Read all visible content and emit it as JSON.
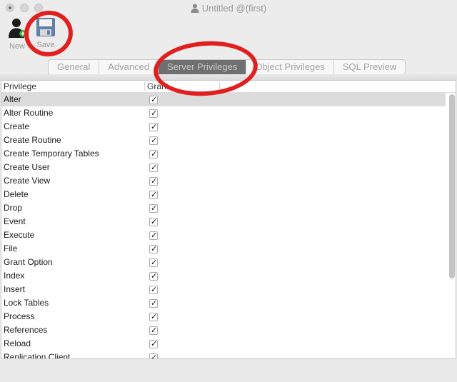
{
  "window": {
    "title": "Untitled @(first)"
  },
  "toolbar": {
    "new_label": "New",
    "save_label": "Save"
  },
  "tabs": [
    {
      "label": "General"
    },
    {
      "label": "Advanced"
    },
    {
      "label": "Server Privileges"
    },
    {
      "label": "Object Privileges"
    },
    {
      "label": "SQL Preview"
    }
  ],
  "active_tab": "Server Privileges",
  "table": {
    "columns": [
      "Privilege",
      "Grant"
    ],
    "rows": [
      {
        "privilege": "Alter",
        "grant": true
      },
      {
        "privilege": "Alter Routine",
        "grant": true
      },
      {
        "privilege": "Create",
        "grant": true
      },
      {
        "privilege": "Create Routine",
        "grant": true
      },
      {
        "privilege": "Create Temporary Tables",
        "grant": true
      },
      {
        "privilege": "Create User",
        "grant": true
      },
      {
        "privilege": "Create View",
        "grant": true
      },
      {
        "privilege": "Delete",
        "grant": true
      },
      {
        "privilege": "Drop",
        "grant": true
      },
      {
        "privilege": "Event",
        "grant": true
      },
      {
        "privilege": "Execute",
        "grant": true
      },
      {
        "privilege": "File",
        "grant": true
      },
      {
        "privilege": "Grant Option",
        "grant": true
      },
      {
        "privilege": "Index",
        "grant": true
      },
      {
        "privilege": "Insert",
        "grant": true
      },
      {
        "privilege": "Lock Tables",
        "grant": true
      },
      {
        "privilege": "Process",
        "grant": true
      },
      {
        "privilege": "References",
        "grant": true
      },
      {
        "privilege": "Reload",
        "grant": true
      },
      {
        "privilege": "Replication Client",
        "grant": true
      }
    ],
    "selected_row": "Alter"
  },
  "colors": {
    "highlight_ring": "#e21f1f",
    "active_tab_bg": "#6f6f6f"
  },
  "icons": {
    "new": "new-user-icon",
    "save": "floppy-disk-icon",
    "title": "user-icon"
  }
}
